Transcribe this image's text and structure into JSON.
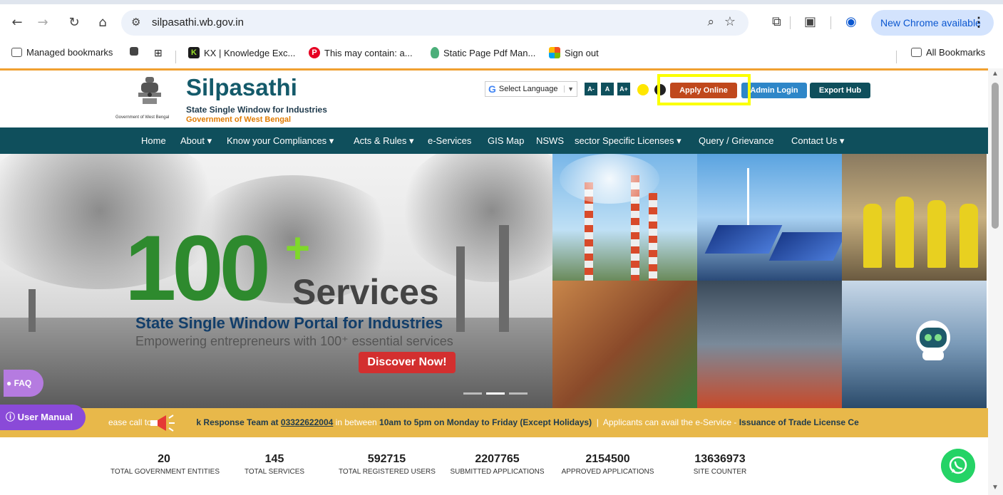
{
  "browser": {
    "url": "silpasathi.wb.gov.in",
    "new_chrome_label": "New Chrome available",
    "bookmarks": [
      {
        "label": "Managed bookmarks"
      },
      {
        "label": "KX | Knowledge Exc..."
      },
      {
        "label": "This may contain: a..."
      },
      {
        "label": "Static Page Pdf Man..."
      },
      {
        "label": "Sign out"
      }
    ],
    "all_bookmarks_label": "All Bookmarks"
  },
  "header": {
    "brand_title": "Silpasathi",
    "brand_subtitle": "State Single Window for Industries",
    "brand_gov": "Government of West Bengal",
    "emblem_caption": "Government of West Bengal",
    "select_language": "Select Language",
    "font_sizes": [
      "A-",
      "A",
      "A+"
    ],
    "apply_online": "Apply Online",
    "admin_login": "Admin Login",
    "export_hub": "Export Hub"
  },
  "nav": {
    "items": [
      "Home",
      "About ▾",
      "Know your Compliances ▾",
      "Acts & Rules ▾",
      "e-Services",
      "GIS Map",
      "NSWS",
      "sector Specific Licenses ▾",
      "Query / Grievance",
      "Contact Us ▾"
    ]
  },
  "hero": {
    "big_number": "100",
    "plus": "+",
    "services_word": "Services",
    "tagline": "State Single Window Portal for Industries",
    "subline": "Empowering entrepreneurs with 100⁺ essential services",
    "cta": "Discover Now!"
  },
  "side_buttons": {
    "faq": "FAQ",
    "user_manual": "User Manual"
  },
  "ticker": {
    "lead": "ease call to",
    "team_label": "k Response Team at",
    "phone": "03322622004",
    "mid": "in between",
    "hours": "10am to 5pm on Monday to Friday (Except Holidays)",
    "sep": "|",
    "tail": "Applicants can avail the e-Service -",
    "tail_bold": "Issuance of Trade License Ce"
  },
  "stats": [
    {
      "value": "20",
      "label": "TOTAL GOVERNMENT ENTITIES"
    },
    {
      "value": "145",
      "label": "TOTAL SERVICES"
    },
    {
      "value": "592715",
      "label": "TOTAL REGISTERED USERS"
    },
    {
      "value": "2207765",
      "label": "SUBMITTED APPLICATIONS"
    },
    {
      "value": "2154500",
      "label": "APPROVED APPLICATIONS"
    },
    {
      "value": "13636973",
      "label": "SITE COUNTER"
    }
  ],
  "colors": {
    "brand_teal": "#0f4f5c",
    "apply_orange": "#c0481c",
    "highlight_yellow": "#fbff00",
    "ticker_gold": "#e8b84a"
  }
}
